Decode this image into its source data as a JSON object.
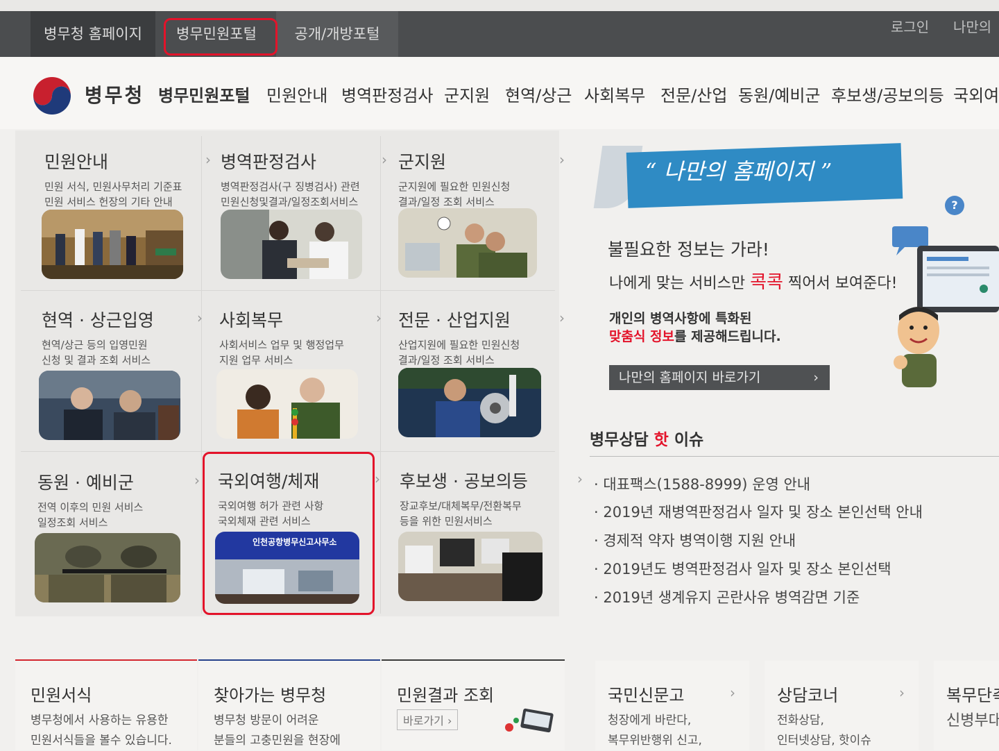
{
  "topbar": {
    "tabs": [
      "병무청 홈페이지",
      "병무민원포털",
      "공개/개방포털"
    ],
    "login": "로그인",
    "my": "나만의"
  },
  "header": {
    "brand": "병무청",
    "portal": "병무민원포털",
    "gnb": [
      "민원안내",
      "병역판정검사",
      "군지원",
      "현역/상근",
      "사회복무",
      "전문/산업",
      "동원/예비군",
      "후보생/공보의등",
      "국외여"
    ]
  },
  "services": [
    {
      "title": "민원안내",
      "desc1": "민원 서식, 민원사무처리 기준표",
      "desc2": "민원 서비스 헌장의 기타 안내"
    },
    {
      "title": "병역판정검사",
      "desc1": "병역판정검사(구 징병검사) 관련",
      "desc2": "민원신청및결과/일정조회서비스"
    },
    {
      "title": "군지원",
      "desc1": "군지원에 필요한 민원신청",
      "desc2": "결과/일정 조회 서비스"
    },
    {
      "title": "현역 · 상근입영",
      "desc1": "현역/상근 등의 입영민원",
      "desc2": "신청 및 결과 조회 서비스"
    },
    {
      "title": "사회복무",
      "desc1": "사회서비스 업무 및 행정업무",
      "desc2": "지원 업무 서비스"
    },
    {
      "title": "전문 · 산업지원",
      "desc1": "산업지원에 필요한 민원신청",
      "desc2": "결과/일정 조회 서비스"
    },
    {
      "title": "동원 · 예비군",
      "desc1": "전역 이후의 민원 서비스",
      "desc2": "일정조회 서비스"
    },
    {
      "title": "국외여행/체재",
      "desc1": "국외여행 허가 관련 사항",
      "desc2": "국외체재 관련 서비스",
      "sign": "인천공항병무신고사무소"
    },
    {
      "title": "후보생 · 공보의등",
      "desc1": "장교후보/대체복무/전환복무",
      "desc2": "등을 위한 민원서비스"
    }
  ],
  "promo": {
    "banner": "“ 나만의 홈페이지 ”",
    "line1": "불필요한 정보는 가라!",
    "line2a": "나에게 맞는 서비스만 ",
    "line2b": "콕콕",
    "line2c": " 찍어서 보여준다!",
    "line3": "개인의 병역사항에 특화된",
    "line4a": "맞춤식 정보",
    "line4b": "를 제공해드립니다.",
    "button": "나만의 홈페이지 바로가기",
    "help": "?"
  },
  "issues": {
    "title_a": "병무상담 ",
    "title_b": "핫",
    "title_c": " 이슈",
    "items": [
      "대표팩스(1588-8999) 운영 안내",
      "2019년 재병역판정검사 일자 및 장소 본인선택 안내",
      "경제적 약자 병역이행 지원 안내",
      "2019년도 병역판정검사 일자 및 장소 본인선택",
      "2019년 생계유지 곤란사유 병역감면 기준"
    ]
  },
  "bottom": [
    {
      "title": "민원서식",
      "d1": "병무청에서 사용하는 유용한",
      "d2": "민원서식들을 볼수 있습니다."
    },
    {
      "title": "찾아가는 병무청",
      "d1": "병무청 방문이 어려운",
      "d2": "분들의 고충민원을 현장에"
    },
    {
      "title": "민원결과 조회",
      "link": "바로가기 ›"
    },
    {
      "title": "국민신문고",
      "d1": "청장에게 바란다,",
      "d2": "복무위반행위 신고,"
    },
    {
      "title": "상담코너",
      "d1": "전화상담,",
      "d2": "인터넷상담, 핫이슈"
    },
    {
      "title": "복무단축",
      "d1": "신병부대"
    }
  ],
  "colors": {
    "accent_red": "#e3132a",
    "banner_blue": "#2f8bc4",
    "topbar": "#4b4d4f"
  }
}
